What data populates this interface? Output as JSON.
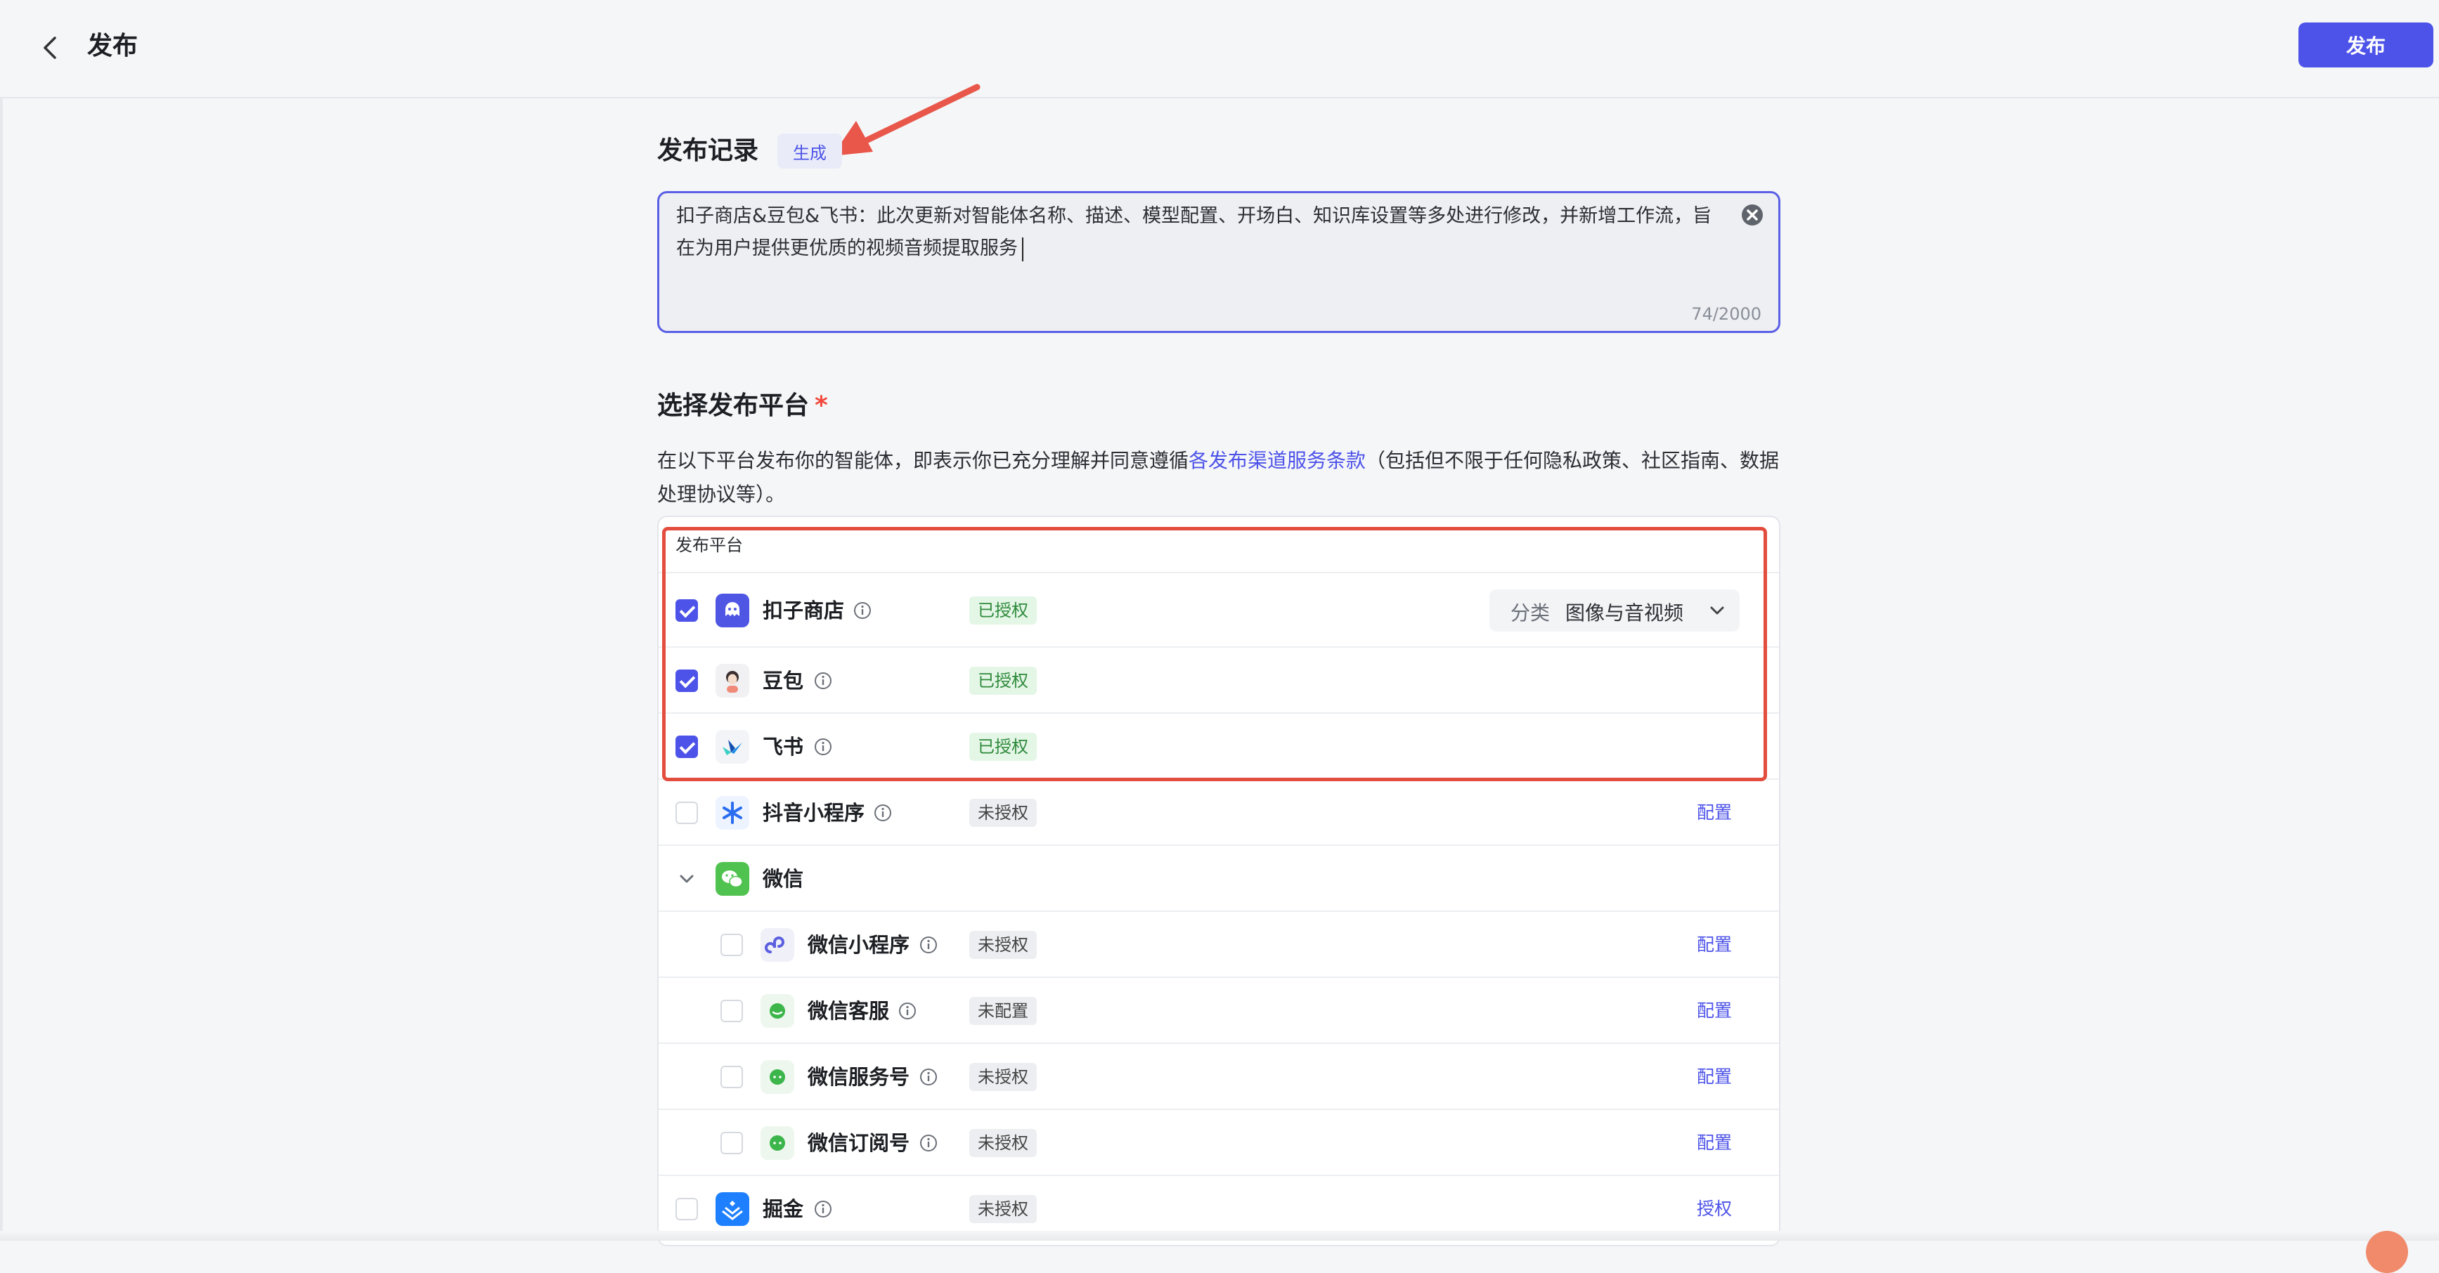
{
  "header": {
    "title": "发布",
    "publish_label": "发布"
  },
  "record": {
    "title": "发布记录",
    "generate_label": "生成",
    "text": "扣子商店&豆包&飞书：此次更新对智能体名称、描述、模型配置、开场白、知识库设置等多处进行修改，并新增工作流，旨在为用户提供更优质的视频音频提取服务",
    "counter": "74/2000"
  },
  "platform_section": {
    "title": "选择发布平台",
    "required_mark": "*",
    "desc_before": "在以下平台发布你的智能体，即表示你已充分理解并同意遵循",
    "desc_link": "各发布渠道服务条款",
    "desc_after": "（包括但不限于任何隐私政策、社区指南、数据处理协议等）。",
    "table_header": "发布平台"
  },
  "platforms": [
    {
      "name": "扣子商店",
      "status": "已授权",
      "checked": true,
      "icon": "coze-store-icon",
      "category": {
        "label": "分类",
        "value": "图像与音视频"
      }
    },
    {
      "name": "豆包",
      "status": "已授权",
      "checked": true,
      "icon": "doubao-icon"
    },
    {
      "name": "飞书",
      "status": "已授权",
      "checked": true,
      "icon": "feishu-icon"
    },
    {
      "name": "抖音小程序",
      "status": "未授权",
      "checked": false,
      "icon": "douyin-miniapp-icon",
      "action": "配置"
    },
    {
      "name": "微信",
      "icon": "wechat-icon",
      "expanded": true,
      "children": [
        {
          "name": "微信小程序",
          "status": "未授权",
          "checked": false,
          "icon": "wechat-miniprogram-icon",
          "action": "配置"
        },
        {
          "name": "微信客服",
          "status": "未配置",
          "checked": false,
          "icon": "wechat-service-icon",
          "action": "配置"
        },
        {
          "name": "微信服务号",
          "status": "未授权",
          "checked": false,
          "icon": "wechat-service-account-icon",
          "action": "配置"
        },
        {
          "name": "微信订阅号",
          "status": "未授权",
          "checked": false,
          "icon": "wechat-subscription-icon",
          "action": "配置"
        }
      ]
    },
    {
      "name": "掘金",
      "status": "未授权",
      "checked": false,
      "icon": "juejin-icon",
      "action": "授权"
    }
  ],
  "colors": {
    "accent": "#4d53e8",
    "required": "#f24a3c",
    "authorized_bg": "#e4f6e6",
    "authorized_text": "#2f8a3c",
    "highlight": "#e24d3d",
    "annotation_arrow": "#e8574a"
  }
}
